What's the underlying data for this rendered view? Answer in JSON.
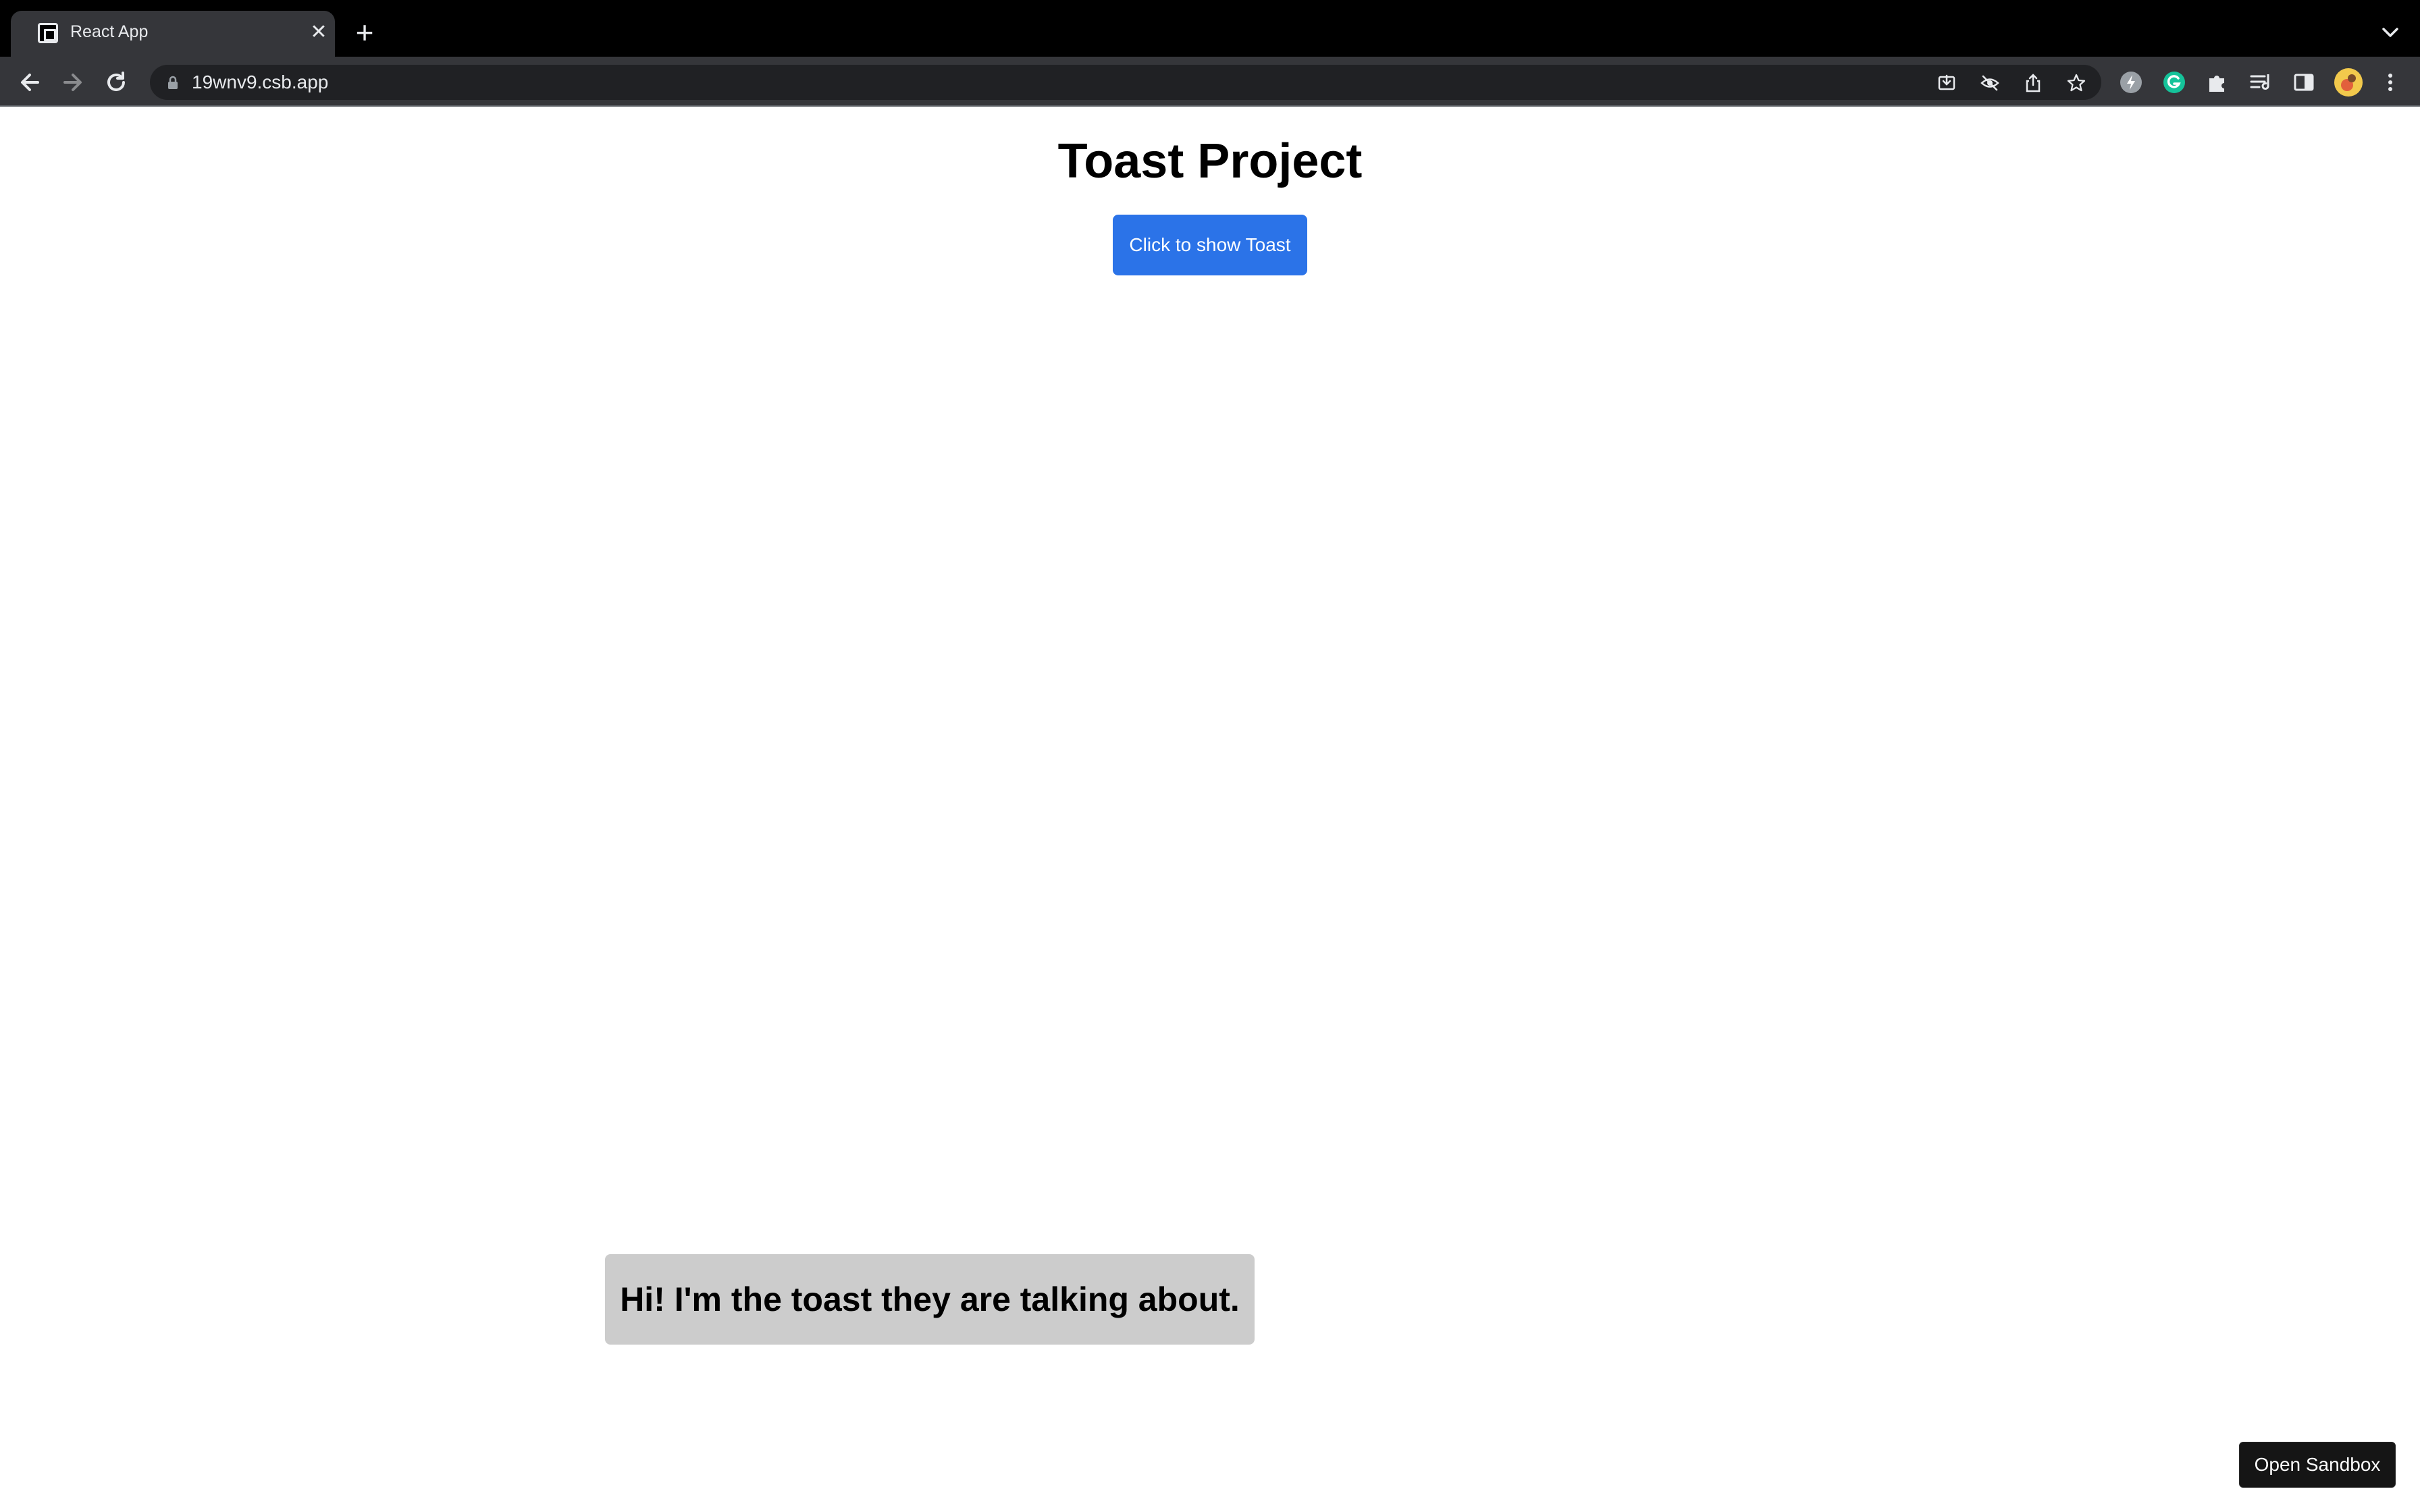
{
  "browser": {
    "tab": {
      "title": "React App",
      "favicon": "square-favicon-icon"
    },
    "new_tab": "+",
    "close_tab": "✕",
    "address_bar": {
      "url": "19wnv9.csb.app"
    },
    "toolbar_icons": [
      "install-icon",
      "eye-off-icon",
      "share-icon",
      "star-icon",
      "extension-lightning-icon",
      "grammarly-icon",
      "puzzle-icon",
      "reading-list-icon",
      "side-panel-icon",
      "avatar",
      "more-menu-icon"
    ]
  },
  "page": {
    "title": "Toast Project",
    "show_toast_button": "Click to show Toast",
    "toast_message": "Hi! I'm the toast they are talking about.",
    "open_sandbox_button": "Open Sandbox"
  },
  "colors": {
    "button_blue": "#2b73e8",
    "toast_bg": "#cccccc",
    "sandbox_bg": "#151515",
    "chrome_dark": "#35363a"
  }
}
